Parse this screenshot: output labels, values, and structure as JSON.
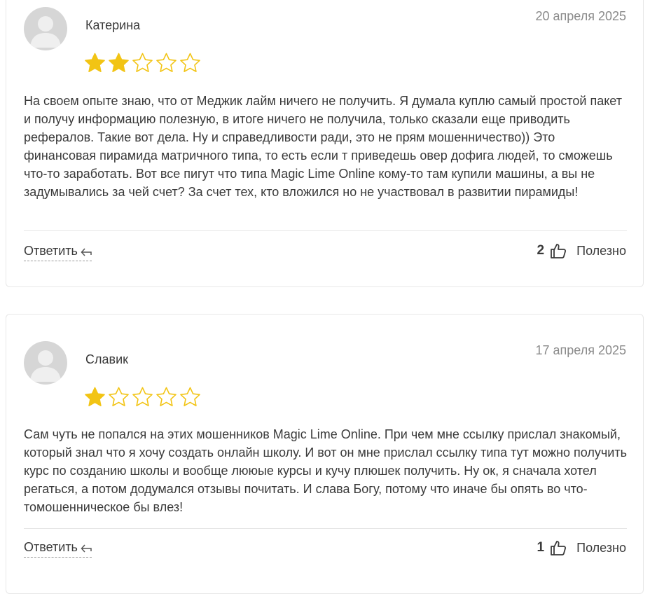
{
  "reviews": [
    {
      "author": "Катерина",
      "date": "20 апреля 2025",
      "rating": 2,
      "rating_max": 5,
      "text": "На своем опыте знаю, что от Меджик лайм ничего не получить. Я думала куплю самый простой пакет и получу информацию полезную, в итоге ничего не получила, только сказали еще приводить рефералов. Такие вот дела. Ну и справедливости ради, это не прям мошенничество)) Это финансовая пирамида матричного типа, то есть если т приведешь овер дофига людей, то сможешь что-то заработать. Вот все пигут что типа Magic Lime Online кому-то там купили машины, а вы не задумывались за чей счет? За счет тех, кто вложился но не участвовал в развитии пирамиды!",
      "reply_label": "Ответить",
      "useful_count": "2",
      "useful_label": "Полезно"
    },
    {
      "author": "Славик",
      "date": "17 апреля 2025",
      "rating": 1,
      "rating_max": 5,
      "text": "Сам чуть не попался на этих мошенников Magic Lime Online. При чем мне ссылку прислал знакомый, который знал что я хочу создать онлайн школу. И вот он мне прислал ссылку типа тут можно получить курс по созданию школы и вообще лююые курсы и кучу плюшек получить. Ну ок, я сначала хотел регаться, а потом додумался отзывы почитать. И слава Богу, потому что иначе бы опять во что-томошенническое бы влез!",
      "reply_label": "Ответить",
      "useful_count": "1",
      "useful_label": "Полезно"
    }
  ],
  "colors": {
    "star_fill": "#f2c414",
    "star_outline": "#f2c414",
    "border": "#e7e7e7",
    "date": "#8a8a8a"
  },
  "icons": {
    "avatar": "user-avatar-icon",
    "star": "star-icon",
    "reply": "reply-arrow-icon",
    "like": "thumbs-up-icon"
  }
}
